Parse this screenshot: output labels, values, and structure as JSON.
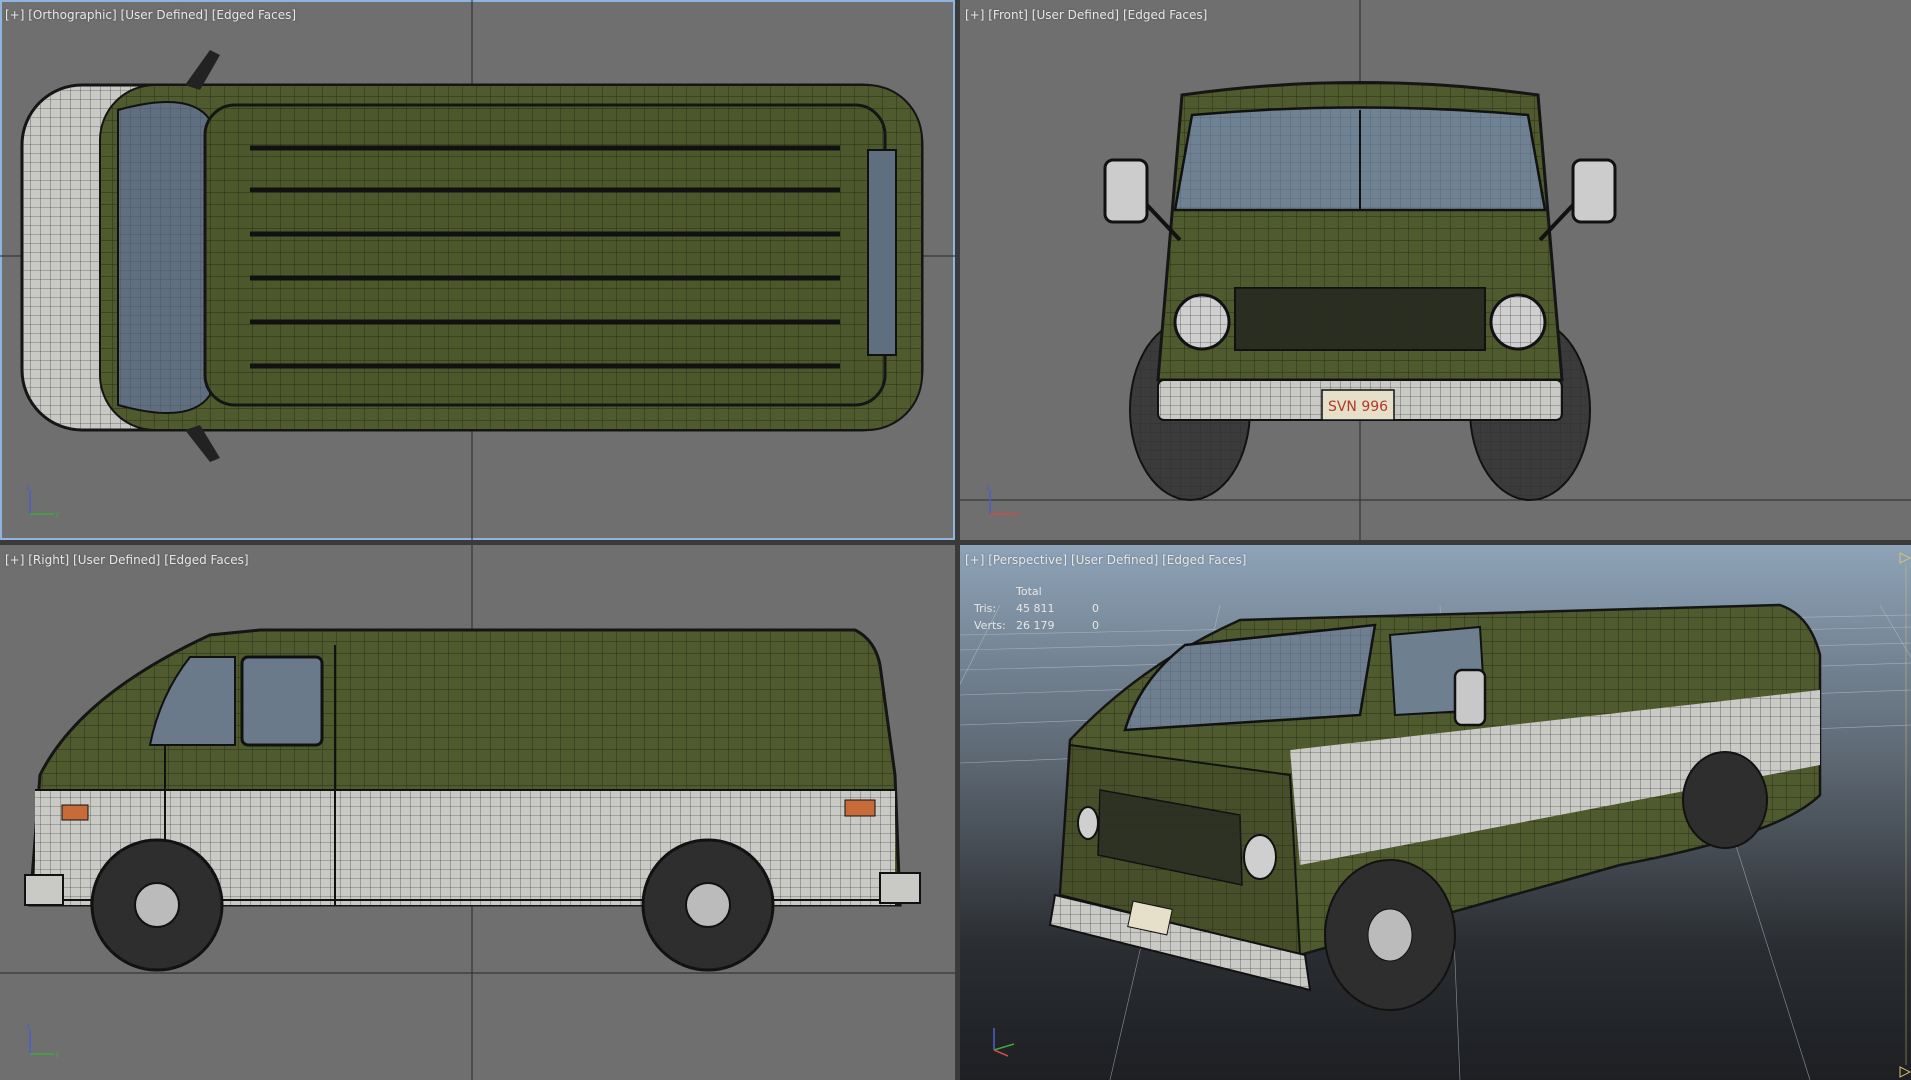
{
  "viewports": {
    "top": {
      "plus": "[+]",
      "view": "[Orthographic]",
      "shading": "[User Defined]",
      "mode": "[Edged Faces]"
    },
    "front": {
      "plus": "[+]",
      "view": "[Front]",
      "shading": "[User Defined]",
      "mode": "[Edged Faces]"
    },
    "right": {
      "plus": "[+]",
      "view": "[Right]",
      "shading": "[User Defined]",
      "mode": "[Edged Faces]"
    },
    "perspective": {
      "plus": "[+]",
      "view": "[Perspective]",
      "shading": "[User Defined]",
      "mode": "[Edged Faces]"
    }
  },
  "stats": {
    "header": "Total",
    "tris_label": "Tris:",
    "tris_value": "45 811",
    "tris_selected": "0",
    "verts_label": "Verts:",
    "verts_value": "26 179",
    "verts_selected": "0"
  },
  "plate_text": "SVN 996",
  "colors": {
    "viewport_bg": "#6f6f6f",
    "active_border": "#8fb4de",
    "body_green": "#4f5a2e",
    "body_white": "#c9c9c5",
    "perspective_sky_top": "#8ea3b8",
    "perspective_sky_bottom": "#1d1f23"
  }
}
